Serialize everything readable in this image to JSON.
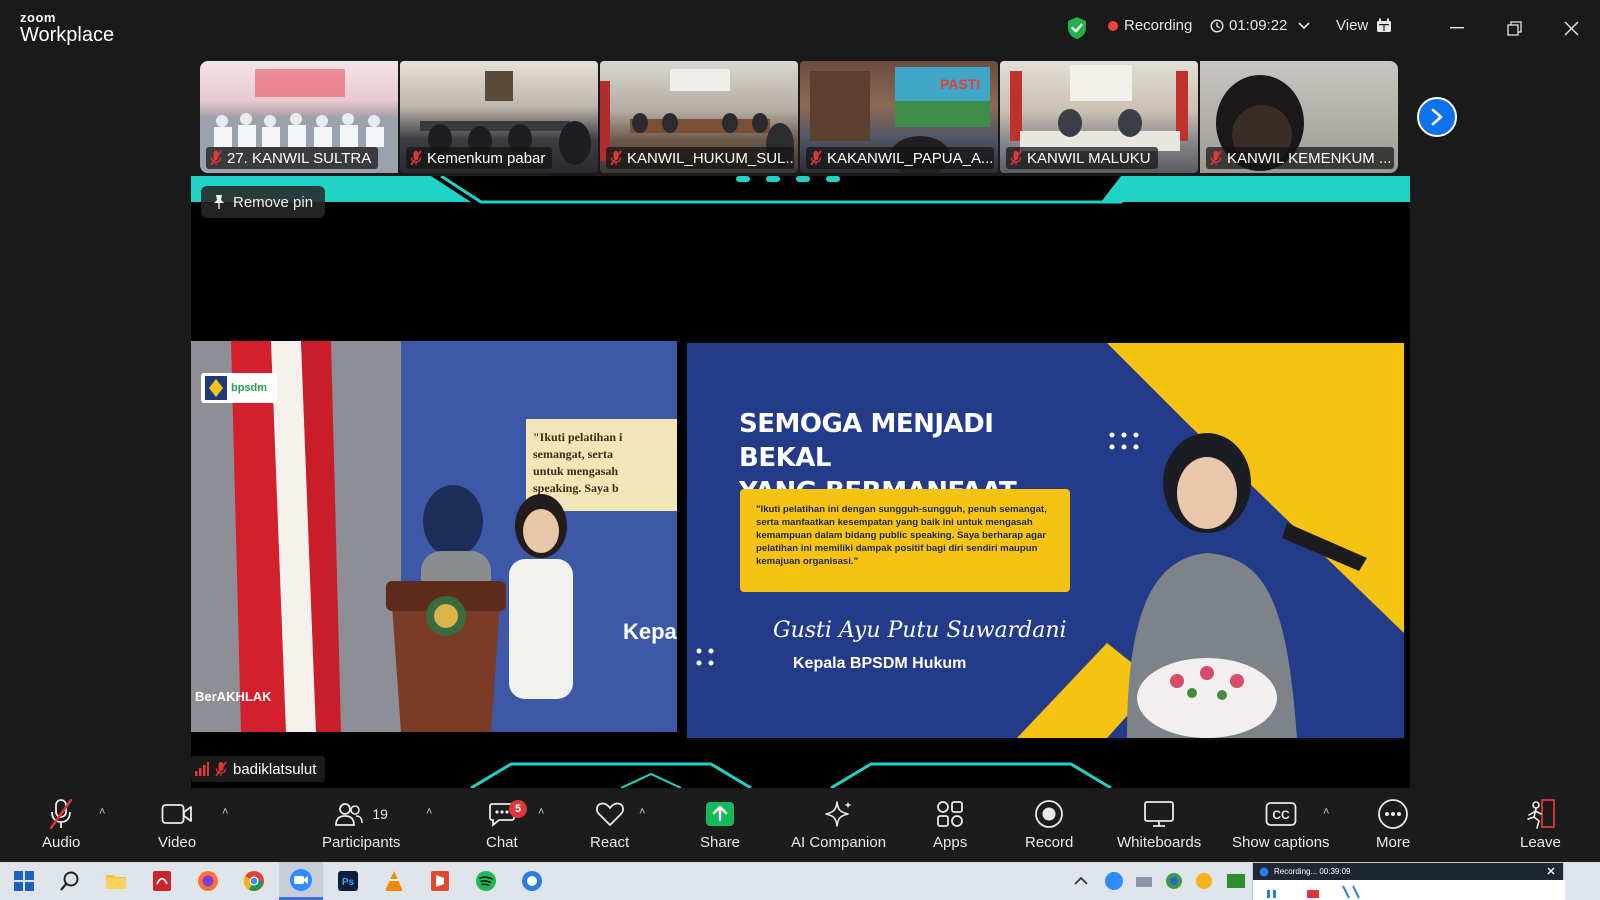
{
  "app": {
    "logo_small": "zoom",
    "logo_name": "Workplace"
  },
  "header": {
    "recording_label": "Recording",
    "timer": "01:09:22",
    "view_label": "View"
  },
  "thumbnails": [
    {
      "name": "27. KANWIL SULTRA"
    },
    {
      "name": "Kemenkum pabar"
    },
    {
      "name": "KANWIL_HUKUM_SUL..."
    },
    {
      "name": "KAKANWIL_PAPUA_A..."
    },
    {
      "name": "KANWIL MALUKU"
    },
    {
      "name": "KANWIL KEMENKUM ..."
    }
  ],
  "stage": {
    "remove_pin_label": "Remove pin",
    "speaker_name": "badiklatsulut",
    "left_video": {
      "logo_text": "bpsdm",
      "bottom_logo": "BerAKHLAK",
      "bg_quote_start": "\"Ikuti pelatihan i",
      "bg_quote_2": "semangat, serta",
      "bg_quote_3": "untuk mengasah",
      "bg_quote_4": "speaking. Saya b",
      "bg_word": "Kepal"
    },
    "slide": {
      "title_line1": "SEMOGA MENJADI BEKAL",
      "title_line2": "YANG BERMANFAAT",
      "quote": "\"Ikuti pelatihan ini dengan sungguh-sungguh, penuh semangat, serta manfaatkan kesempatan yang baik ini untuk mengasah kemampuan dalam bidang public speaking. Saya berharap agar pelatihan ini memiliki dampak positif bagi diri sendiri maupun kemajuan organisasi.\"",
      "signature": "Gusti Ayu Putu Suwardani",
      "signer_title": "Kepala BPSDM Hukum"
    }
  },
  "toolbar": {
    "audio": "Audio",
    "video": "Video",
    "participants": "Participants",
    "participants_count": "19",
    "chat": "Chat",
    "chat_badge": "5",
    "react": "React",
    "share": "Share",
    "ai_companion": "AI Companion",
    "apps": "Apps",
    "record": "Record",
    "whiteboards": "Whiteboards",
    "show_captions": "Show captions",
    "more": "More",
    "leave": "Leave"
  },
  "taskbar": {
    "recording_preview_title": "Recording... 00:39:09"
  },
  "colors": {
    "accent_blue": "#0e72ed",
    "recording_red": "#f0433a",
    "mute_red": "#e0363a",
    "share_green": "#12b85a",
    "slide_navy": "#243b8a",
    "slide_yellow": "#f6c313",
    "stage_teal": "#1fd3c6"
  }
}
